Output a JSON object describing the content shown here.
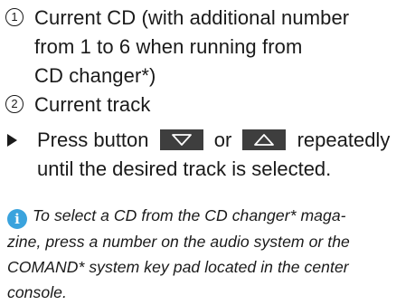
{
  "items": [
    {
      "number": "1",
      "lines": [
        "Current CD (with additional number",
        "from 1 to 6 when running from",
        "CD changer*)"
      ]
    },
    {
      "number": "2",
      "lines": [
        "Current track"
      ]
    }
  ],
  "instruction": {
    "part1": "Press button",
    "part2": "or",
    "part3": "repeatedly",
    "line2": "until the desired track is selected.",
    "button_down_icon": "down-arrow-icon",
    "button_up_icon": "up-arrow-icon"
  },
  "note": {
    "icon": "info-icon",
    "icon_letter": "i",
    "lines": [
      "To select a CD from the CD changer* maga-",
      "zine, press a number on the audio system or the",
      "COMAND* system key pad located in the center",
      "console."
    ]
  },
  "colors": {
    "text": "#1a1a1a",
    "button_bg": "#3e3e3e",
    "info_icon": "#3aa3dd"
  }
}
